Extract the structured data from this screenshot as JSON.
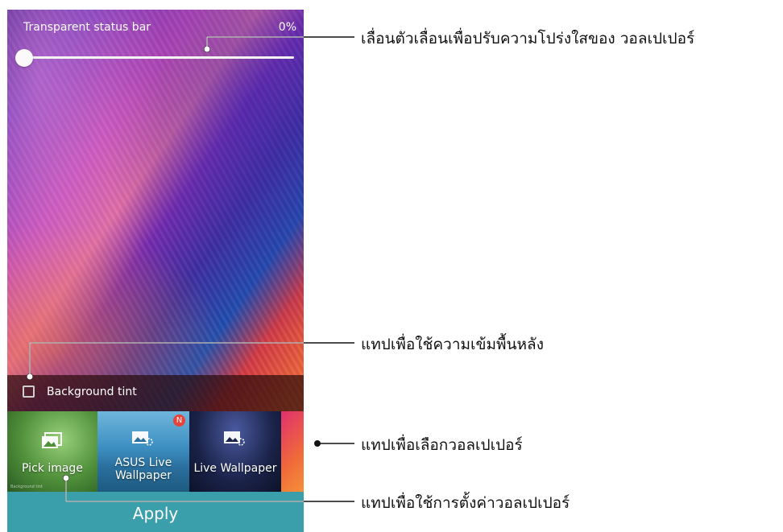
{
  "status_bar": {
    "title": "Transparent status bar",
    "percent": "0%",
    "transparency_value": 0
  },
  "background_tint": {
    "label": "Background tint",
    "checked": false
  },
  "wallpapers": [
    {
      "label": "Pick image",
      "icon": "image-icon"
    },
    {
      "label_line1": "ASUS Live",
      "label_line2": "Wallpaper",
      "icon": "image-loading-icon",
      "badge": "N"
    },
    {
      "label": "Live Wallpaper",
      "icon": "image-loading-icon"
    }
  ],
  "tiny_caption": "Background tint",
  "apply_label": "Apply",
  "callouts": {
    "slider": "เลื่อนตัวเลื่อนเพื่อปรับความโปร่งใสของ วอลเปเปอร์",
    "tint": "แทปเพื่อใช้ความเข้มพื้นหลัง",
    "select": "แทปเพื่อเลือกวอลเปเปอร์",
    "apply": "แทปเพื่อใช้การตั้งค่าวอลเปเปอร์"
  },
  "colors": {
    "apply_bar": "#3a9faa",
    "badge": "#e8423a"
  }
}
